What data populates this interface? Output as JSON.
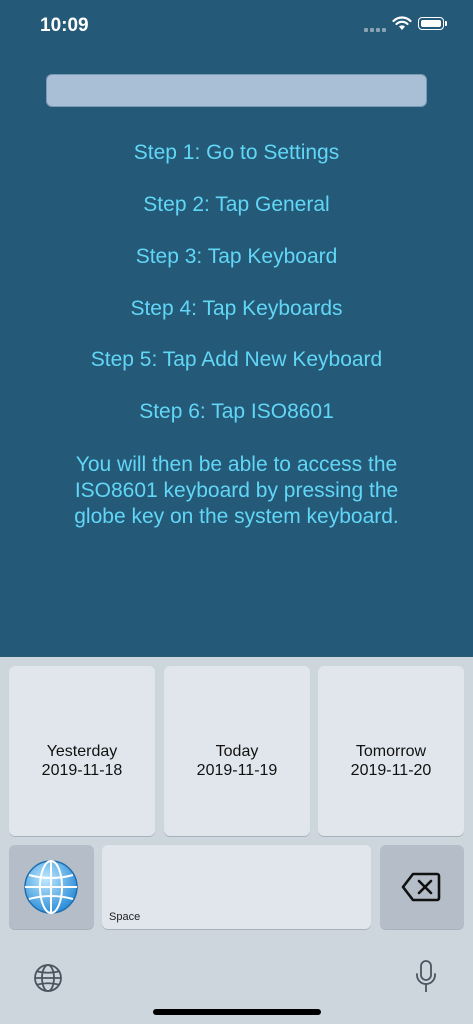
{
  "status_bar": {
    "time": "10:09"
  },
  "search": {
    "placeholder": ""
  },
  "steps": [
    "Step 1: Go to Settings",
    "Step 2: Tap General",
    "Step 3: Tap Keyboard",
    "Step 4: Tap Keyboards",
    "Step 5: Tap Add New Keyboard",
    "Step 6: Tap ISO8601"
  ],
  "instructions": [
    "You will then be able to access the",
    "ISO8601 keyboard by pressing the",
    "globe key on the system keyboard."
  ],
  "keyboard": {
    "date_keys": [
      {
        "label": "Yesterday",
        "date": "2019-11-18"
      },
      {
        "label": "Today",
        "date": "2019-11-19"
      },
      {
        "label": "Tomorrow",
        "date": "2019-11-20"
      }
    ],
    "space_label": "Space",
    "globe_icon": "globe-emoji-icon",
    "backspace_icon": "backspace-icon"
  },
  "system_bar": {
    "left_icon": "globe-icon",
    "right_icon": "microphone-icon"
  },
  "colors": {
    "background": "#245a78",
    "step_text": "#62d6f6",
    "keyboard_bg": "#cdd5dd",
    "key_bg": "#e1e6ec"
  }
}
